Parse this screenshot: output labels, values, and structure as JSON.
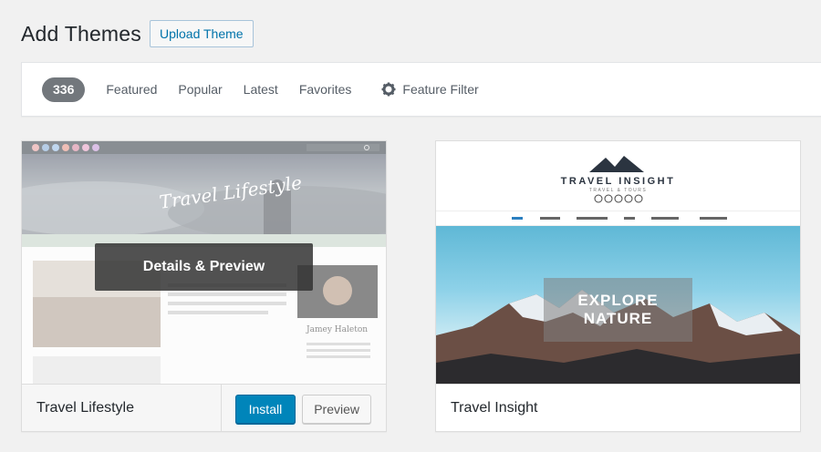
{
  "header": {
    "title": "Add Themes",
    "upload_label": "Upload Theme"
  },
  "filters": {
    "count": "336",
    "tabs": [
      "Featured",
      "Popular",
      "Latest",
      "Favorites"
    ],
    "feature_filter_label": "Feature Filter"
  },
  "themes": [
    {
      "name": "Travel Lifestyle",
      "overlay_label": "Details & Preview",
      "install_label": "Install",
      "preview_label": "Preview",
      "thumb": {
        "logo": "Travel Lifestyle",
        "search_placeholder": "Search",
        "profile_name": "Jamey Haleton"
      }
    },
    {
      "name": "Travel Insight",
      "thumb": {
        "logo": "TRAVEL INSIGHT",
        "tagline": "TRAVEL & TOURS",
        "hero_line1": "EXPLORE",
        "hero_line2": "NATURE"
      }
    }
  ],
  "colors": {
    "install_blue": "#0085ba",
    "link_blue": "#0073aa",
    "badge_gray": "#72777c",
    "page_bg": "#f1f1f1"
  }
}
